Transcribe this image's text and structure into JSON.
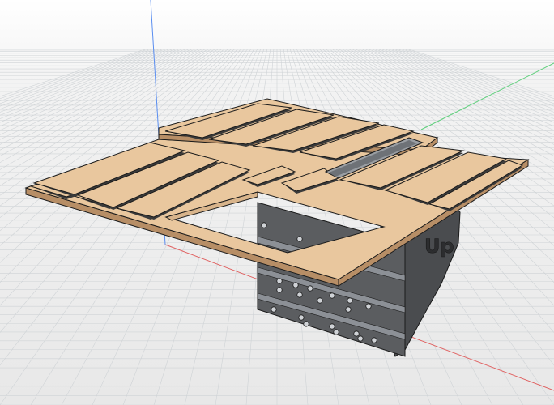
{
  "scene": {
    "name": "Table top with slats on a bracket (CAD 3D view)",
    "colors": {
      "background_top": "#ffffff",
      "background_bottom": "#e8e8e8",
      "grid": "#cfd3d6",
      "axis_x": "#e06060",
      "axis_y": "#5ccf7a",
      "axis_z": "#5a8ef0",
      "wood": "#e9c79e",
      "wood_edge": "#b78e66",
      "bracket": "#4a4c4f",
      "bracket_face": "#5b5d60",
      "slot": "#8c9096",
      "outline": "#1b1b1b"
    },
    "bracket_label": "Up"
  }
}
